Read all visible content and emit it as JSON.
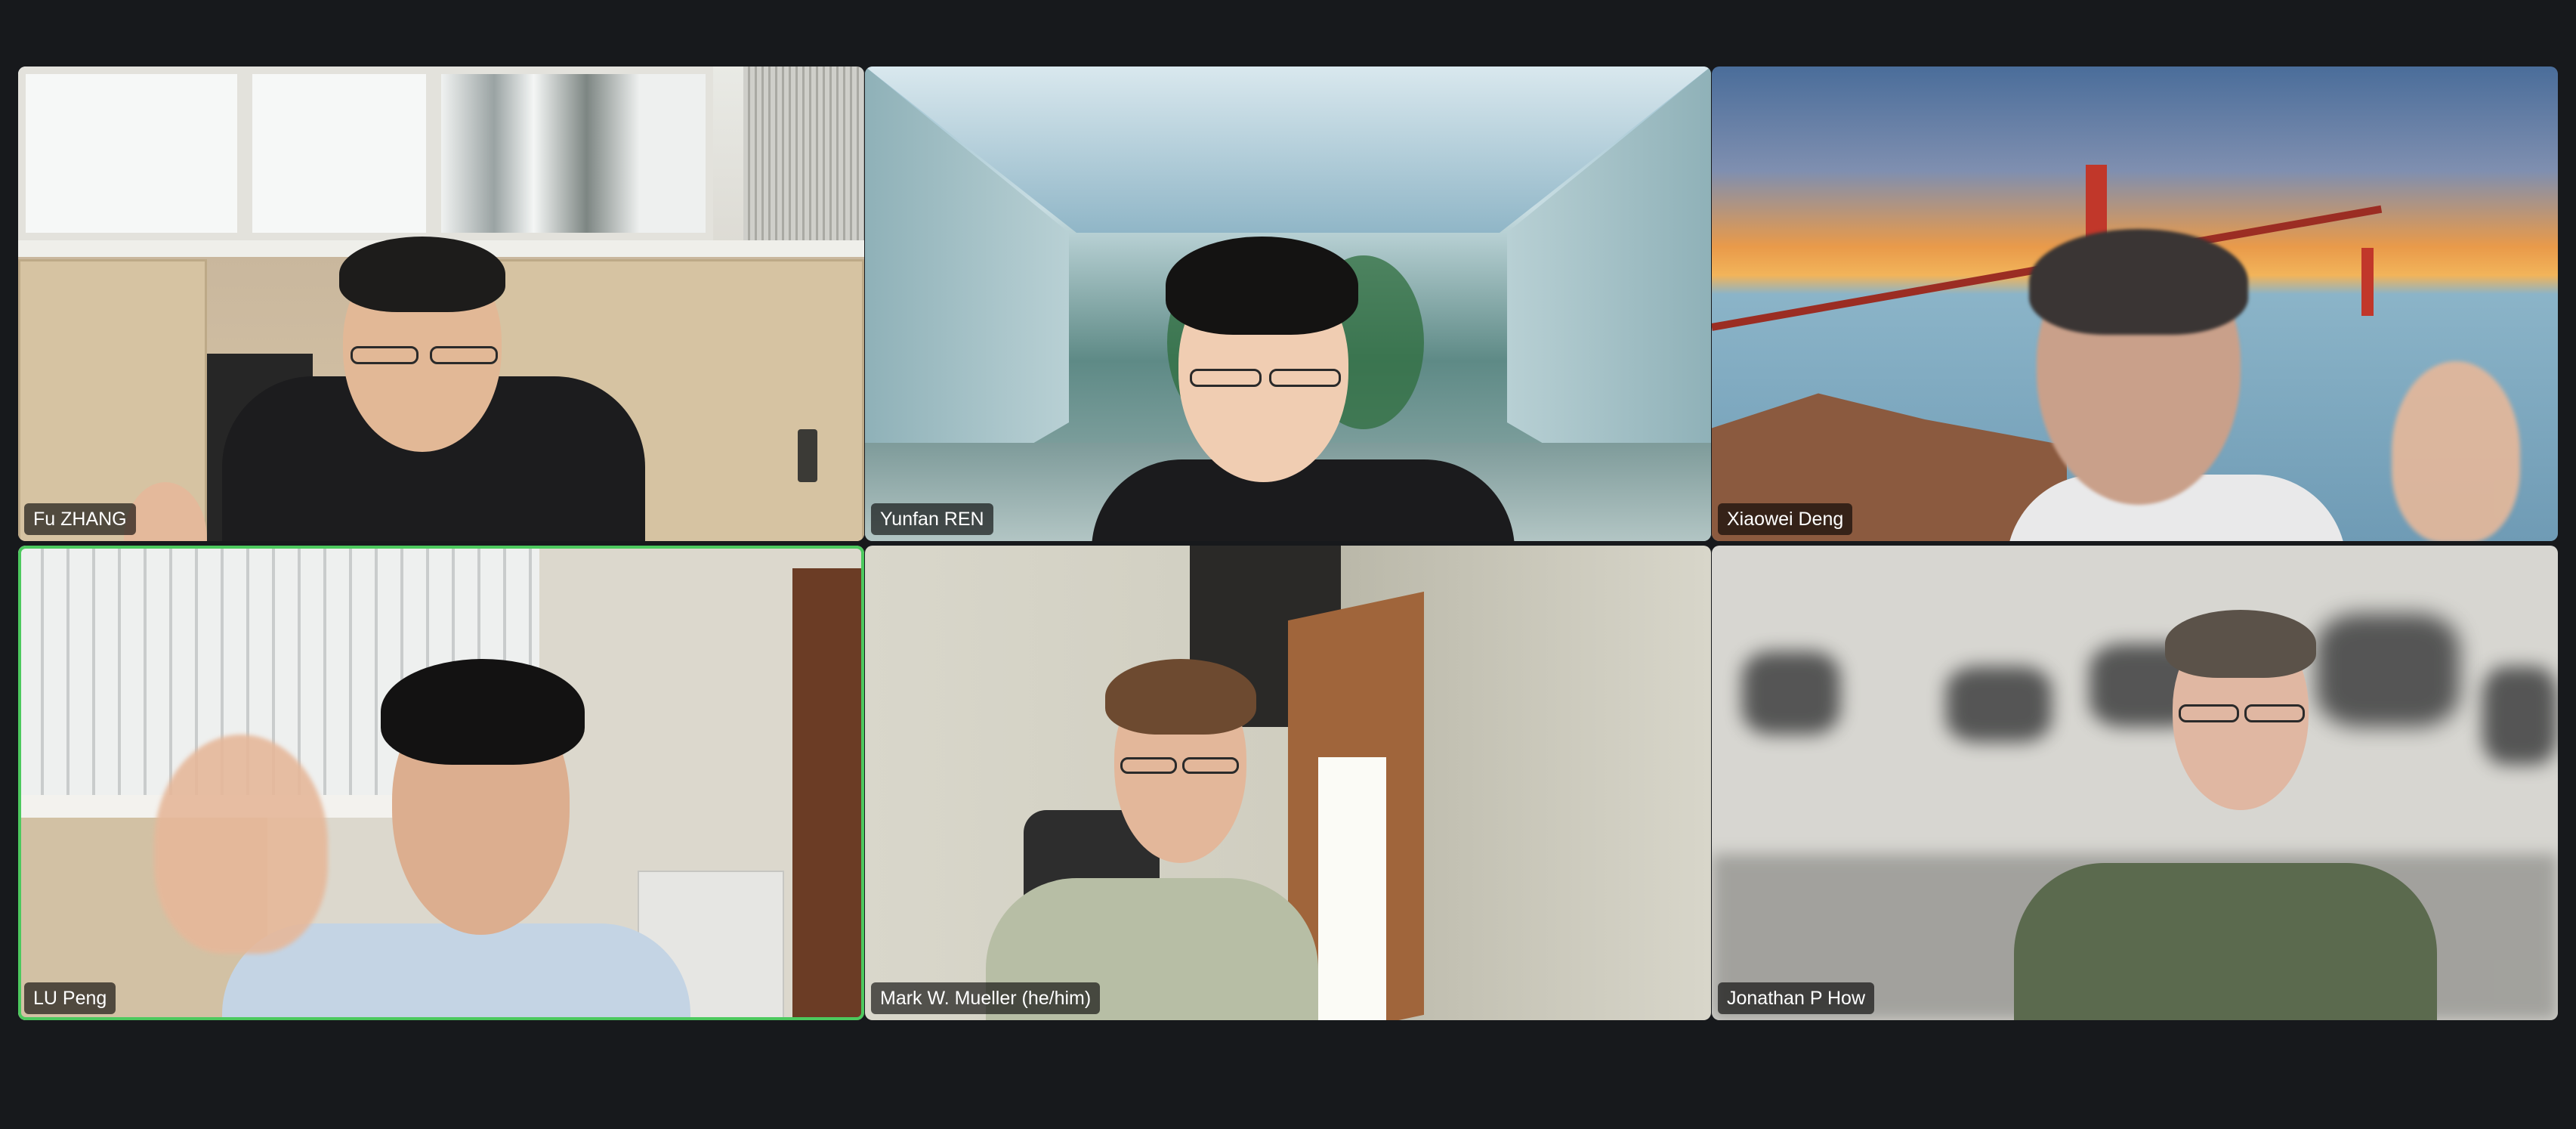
{
  "meeting": {
    "participants": [
      {
        "name": "Fu ZHANG",
        "active": false
      },
      {
        "name": "Yunfan REN",
        "active": false
      },
      {
        "name": "Xiaowei Deng",
        "active": false
      },
      {
        "name": "LU Peng",
        "active": true
      },
      {
        "name": "Mark W. Mueller (he/him)",
        "active": false
      },
      {
        "name": "Jonathan P How",
        "active": false
      }
    ]
  },
  "colors": {
    "background": "#17191c",
    "active_speaker_border": "#4cc95e",
    "label_background": "rgba(0,0,0,0.62)",
    "label_text": "#ffffff"
  }
}
